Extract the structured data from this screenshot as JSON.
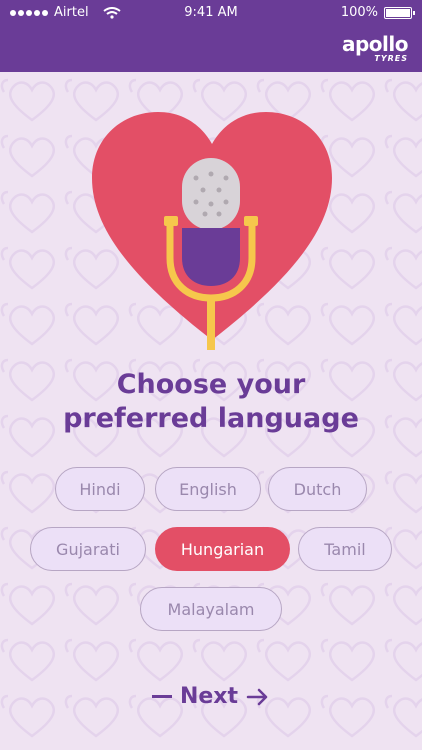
{
  "status_bar": {
    "carrier": "Airtel",
    "time": "9:41 AM",
    "battery": "100%"
  },
  "header": {
    "logo_name": "apollo",
    "logo_sub": "TYRES"
  },
  "colors": {
    "brand_purple": "#6a3c97",
    "heart_red": "#e34f66",
    "background": "#efe3f2"
  },
  "hero": {
    "icon": "heart-microphone-illustration"
  },
  "title": {
    "line1": "Choose your",
    "line2": "preferred language"
  },
  "languages": [
    {
      "label": "Hindi",
      "selected": false
    },
    {
      "label": "English",
      "selected": false
    },
    {
      "label": "Dutch",
      "selected": false
    },
    {
      "label": "Gujarati",
      "selected": false
    },
    {
      "label": "Hungarian",
      "selected": true
    },
    {
      "label": "Tamil",
      "selected": false
    },
    {
      "label": "Malayalam",
      "selected": false
    }
  ],
  "next": {
    "label": "Next"
  }
}
